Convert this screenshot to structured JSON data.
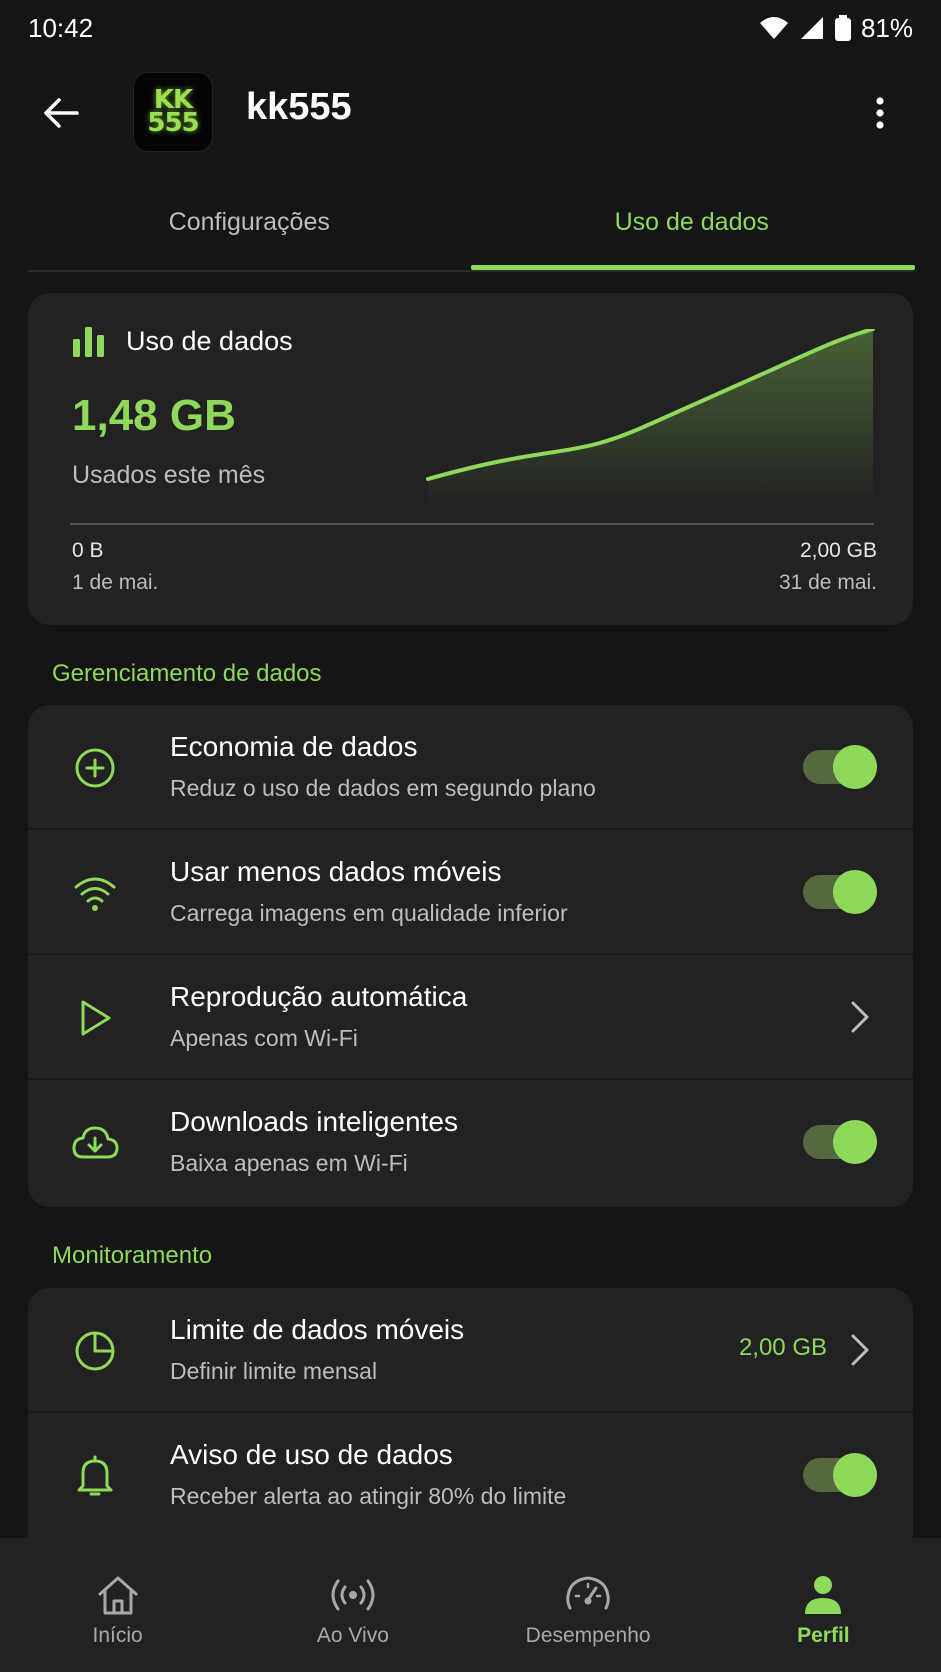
{
  "status_bar": {
    "time": "10:42",
    "battery": "81%"
  },
  "app_bar": {
    "logo_line1": "KK",
    "logo_line2": "555",
    "title": "kk555"
  },
  "tabs": [
    {
      "label": "Configurações",
      "active": false
    },
    {
      "label": "Uso de dados",
      "active": true
    }
  ],
  "usage_card": {
    "title": "Uso de dados",
    "value": "1,48 GB",
    "subtitle": "Usados este mês",
    "axis_start_value": "0 B",
    "axis_start_date": "1 de mai.",
    "axis_end_value": "2,00 GB",
    "axis_end_date": "31 de mai.",
    "accent_color": "#8ed85a"
  },
  "sections": {
    "data_management": "Gerenciamento de dados",
    "monitoring": "Monitoramento"
  },
  "data_management_rows": [
    {
      "title": "Economia de dados",
      "subtitle": "Reduz o uso de dados em segundo plano",
      "icon": "data-saver-icon",
      "toggle": true
    },
    {
      "title": "Usar menos dados móveis",
      "subtitle": "Carrega imagens em qualidade inferior",
      "icon": "wifi-icon",
      "toggle": true
    },
    {
      "title": "Reprodução automática",
      "subtitle": "Apenas com Wi-Fi",
      "icon": "play-icon",
      "toggle": null
    },
    {
      "title": "Downloads inteligentes",
      "subtitle": "Baixa apenas em Wi-Fi",
      "icon": "cloud-download-icon",
      "toggle": true
    }
  ],
  "monitoring_rows": [
    {
      "title": "Limite de dados móveis",
      "subtitle": "Definir limite mensal",
      "value": "2,00 GB",
      "icon": "pie-chart-icon"
    },
    {
      "title": "Aviso de uso de dados",
      "subtitle": "Receber alerta ao atingir 80% do limite",
      "icon": "bell-icon",
      "toggle": true
    }
  ],
  "bottom_nav": [
    {
      "label": "Início",
      "icon": "home-icon",
      "active": false
    },
    {
      "label": "Ao Vivo",
      "icon": "live-icon",
      "active": false
    },
    {
      "label": "Desempenho",
      "icon": "speedometer-icon",
      "active": false
    },
    {
      "label": "Perfil",
      "icon": "person-icon",
      "active": true
    }
  ]
}
